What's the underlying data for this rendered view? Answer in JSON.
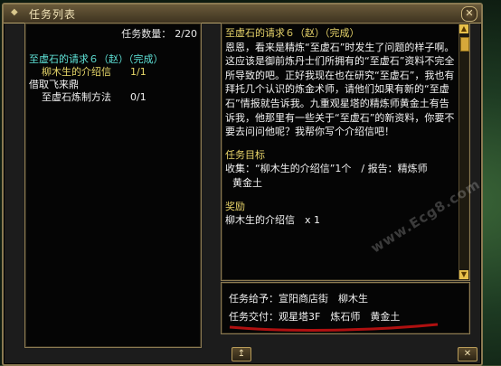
{
  "window": {
    "title": "任务列表",
    "close_label": "✕"
  },
  "left": {
    "count_label": "任务数量：",
    "count_value": "2/20",
    "items": [
      {
        "label": "至虚石的请求６（赵）（完成）",
        "qty": ""
      },
      {
        "label": "柳木生的介绍信",
        "qty": "1/1"
      },
      {
        "label": "借取飞来鼎",
        "qty": ""
      },
      {
        "label": "至虚石炼制方法",
        "qty": "0/1"
      }
    ]
  },
  "detail": {
    "title": "至虚石的请求６（赵）（完成）",
    "body": "恩恩，看来是精炼“至虚石”时发生了问题的样子啊。这应该是御前炼丹士们所拥有的“至虚石”资料不完全所导致的吧。正好我现在也在研究“至虚石”，我也有拜托几个认识的炼金术师，请他们如果有新的“至虚石”情报就告诉我。九重观星塔的精炼师黄金土有告诉我，他那里有一些关于“至虚石”的新资料，你要不要去问问他呢？我帮你写个介绍信吧！",
    "objective_heading": "任务目标",
    "objective_text": "收集：“柳木生的介绍信”1个　/ 报告：精炼师",
    "objective_text2": "黄金土",
    "reward_heading": "奖励",
    "reward_text": "柳木生的介绍信　x 1"
  },
  "giver": {
    "from_label": "任务给予：宣阳商店街　柳木生",
    "to_label": "任务交付：观星塔3F　炼石师　黄金土"
  },
  "buttons": {
    "abandon": "↥",
    "close": "✕"
  },
  "watermark": "www.Ecg8.com",
  "colors": {
    "accent_cyan": "#5fe3d8",
    "accent_yellow": "#e8d46a",
    "border": "#8b7a52"
  }
}
